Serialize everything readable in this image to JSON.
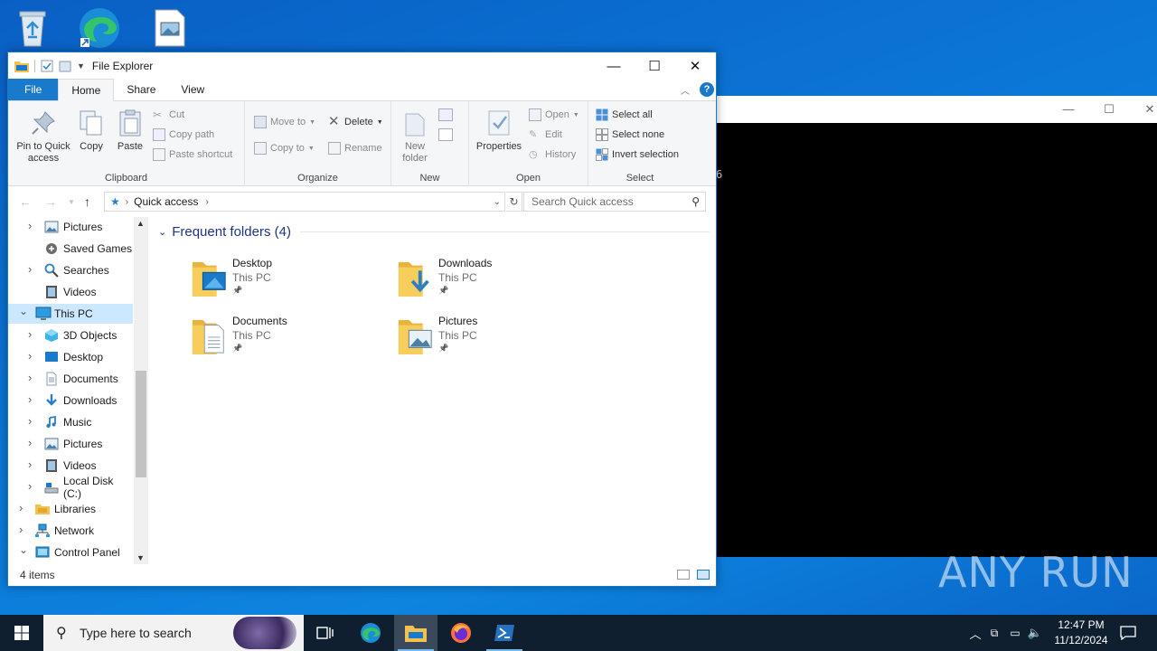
{
  "window": {
    "title": "File Explorer",
    "minimize": "—",
    "maximize": "☐",
    "close": "✕"
  },
  "tabs": [
    "File",
    "Home",
    "Share",
    "View"
  ],
  "ribbon": {
    "clipboard": {
      "label": "Clipboard",
      "pin": "Pin to Quick access",
      "copy": "Copy",
      "paste": "Paste",
      "cut": "Cut",
      "copy_path": "Copy path",
      "paste_shortcut": "Paste shortcut"
    },
    "organize": {
      "label": "Organize",
      "move_to": "Move to",
      "copy_to": "Copy to",
      "delete": "Delete",
      "rename": "Rename"
    },
    "new": {
      "label": "New",
      "new_folder": "New folder"
    },
    "open": {
      "label": "Open",
      "properties": "Properties",
      "open": "Open",
      "edit": "Edit",
      "history": "History"
    },
    "select": {
      "label": "Select",
      "select_all": "Select all",
      "select_none": "Select none",
      "invert": "Invert selection"
    }
  },
  "address": {
    "crumb": "Quick access",
    "search_placeholder": "Search Quick access"
  },
  "nav_pane": [
    {
      "label": "Pictures",
      "icon": "pictures-icon",
      "expander": true
    },
    {
      "label": "Saved Games",
      "icon": "saved-games-icon",
      "expander": false
    },
    {
      "label": "Searches",
      "icon": "searches-icon",
      "expander": true
    },
    {
      "label": "Videos",
      "icon": "videos-icon",
      "expander": false
    },
    {
      "label": "This PC",
      "icon": "this-pc-icon",
      "expander": true,
      "expanded": true,
      "selected": true
    },
    {
      "label": "3D Objects",
      "icon": "3d-objects-icon",
      "expander": true
    },
    {
      "label": "Desktop",
      "icon": "desktop-icon",
      "expander": true
    },
    {
      "label": "Documents",
      "icon": "documents-icon",
      "expander": true
    },
    {
      "label": "Downloads",
      "icon": "downloads-icon",
      "expander": true
    },
    {
      "label": "Music",
      "icon": "music-icon",
      "expander": true
    },
    {
      "label": "Pictures",
      "icon": "pictures-icon",
      "expander": true
    },
    {
      "label": "Videos",
      "icon": "videos-icon",
      "expander": true
    },
    {
      "label": "Local Disk (C:)",
      "icon": "drive-icon",
      "expander": true
    },
    {
      "label": "Libraries",
      "icon": "libraries-icon",
      "expander": true
    },
    {
      "label": "Network",
      "icon": "network-icon",
      "expander": true
    },
    {
      "label": "Control Panel",
      "icon": "control-panel-icon",
      "expander": true,
      "expanded": true
    }
  ],
  "content": {
    "section_title": "Frequent folders (4)",
    "folders": [
      {
        "name": "Desktop",
        "location": "This PC",
        "icon": "desktop-folder-icon"
      },
      {
        "name": "Downloads",
        "location": "This PC",
        "icon": "downloads-folder-icon"
      },
      {
        "name": "Documents",
        "location": "This PC",
        "icon": "documents-folder-icon"
      },
      {
        "name": "Pictures",
        "location": "This PC",
        "icon": "pictures-folder-icon"
      }
    ]
  },
  "status": {
    "items": "4 items"
  },
  "taskbar": {
    "search_placeholder": "Type here to search",
    "time": "12:47 PM",
    "date": "11/12/2024"
  },
  "console": {
    "partial_char": "6"
  },
  "watermark": "ANY RUN",
  "colors": {
    "accent": "#1979ca",
    "selection": "#cce8ff",
    "taskbar": "#101f30",
    "section_header": "#1e3287"
  }
}
